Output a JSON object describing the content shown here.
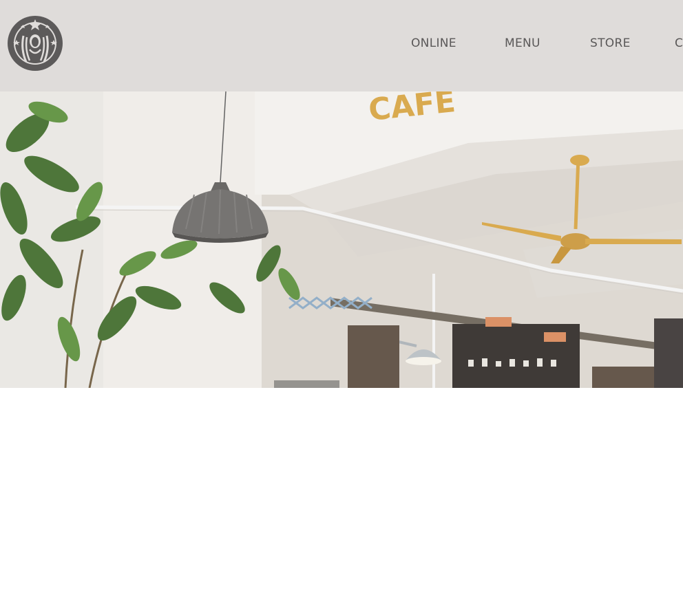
{
  "brand": {
    "logo_icon": "siren-logo-icon"
  },
  "nav": {
    "items": [
      {
        "label": "ONLINE"
      },
      {
        "label": "MENU"
      },
      {
        "label": "STORE"
      },
      {
        "label": "C"
      }
    ]
  },
  "hero": {
    "sign_text": "CAFE",
    "icons": [
      "plant-icon",
      "pendant-lamp-icon",
      "ceiling-fan-icon",
      "wall-lamp-icon",
      "menu-board-icon"
    ]
  },
  "colors": {
    "header_bg": "#dfdcda",
    "nav_text": "#5a5858",
    "accent_yellow": "#d6a341"
  }
}
